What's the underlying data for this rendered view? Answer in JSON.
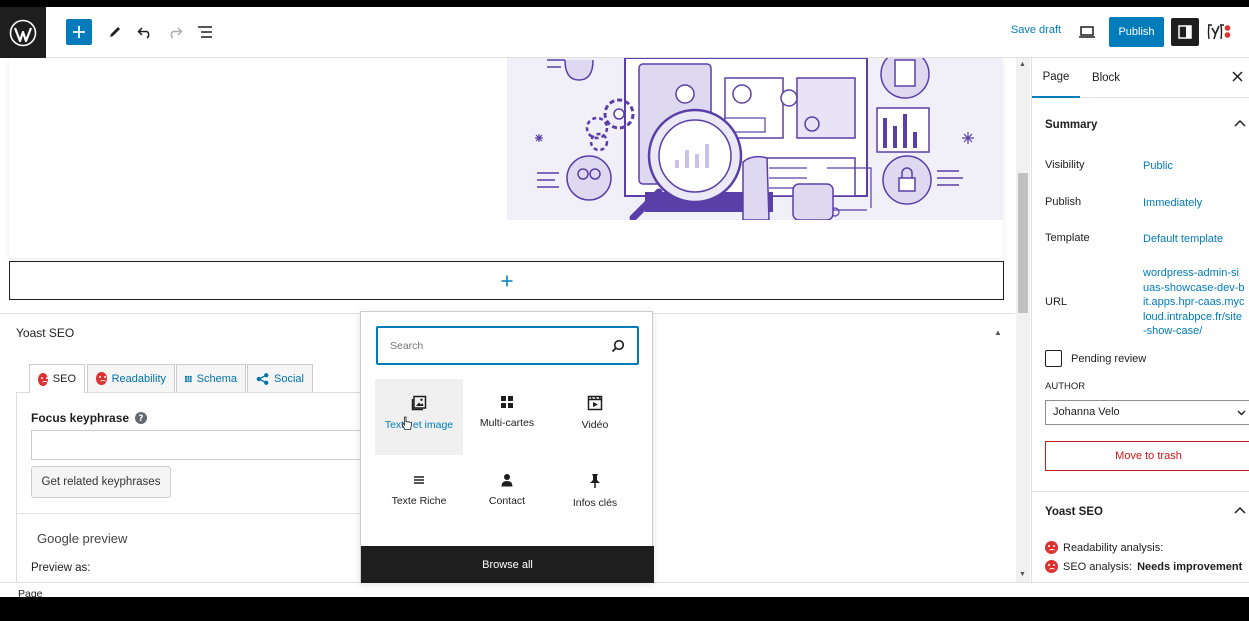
{
  "toolbar": {
    "save_draft": "Save draft",
    "publish": "Publish",
    "yoast_logo": "y"
  },
  "metabox": {
    "title": "Yoast SEO",
    "tabs": [
      {
        "label": "SEO",
        "icon": "sad-face-icon"
      },
      {
        "label": "Readability",
        "icon": "sad-face-icon"
      },
      {
        "label": "Schema",
        "icon": "grid-icon"
      },
      {
        "label": "Social",
        "icon": "share-icon"
      }
    ],
    "focus_keyphrase_label": "Focus keyphrase",
    "related_button": "Get related keyphrases",
    "google_preview": "Google preview",
    "preview_as": "Preview as:"
  },
  "inserter": {
    "search_placeholder": "Search",
    "blocks": [
      {
        "label": "Texte et image",
        "icon": "image-text-icon"
      },
      {
        "label": "Multi-cartes",
        "icon": "grid-icon"
      },
      {
        "label": "Vidéo",
        "icon": "video-icon"
      },
      {
        "label": "Texte Riche",
        "icon": "text-lines-icon"
      },
      {
        "label": "Contact",
        "icon": "person-icon"
      },
      {
        "label": "Infos clés",
        "icon": "pin-icon"
      }
    ],
    "browse_all": "Browse all"
  },
  "sidebar": {
    "tab_page": "Page",
    "tab_block": "Block",
    "summary_title": "Summary",
    "visibility_label": "Visibility",
    "visibility_value": "Public",
    "publish_label": "Publish",
    "publish_value": "Immediately",
    "template_label": "Template",
    "template_value": "Default template",
    "url_label": "URL",
    "url_value": "wordpress-admin-siuas-showcase-dev-bit.apps.hpr-caas.mycloud.intrabpce.fr/site-show-case/",
    "pending_review": "Pending review",
    "author_label": "AUTHOR",
    "author_value": "Johanna Velo",
    "move_to_trash": "Move to trash",
    "yoast_title": "Yoast SEO",
    "readability_analysis": "Readability analysis:",
    "seo_analysis_prefix": "SEO analysis:",
    "seo_analysis_value": "Needs improvement"
  },
  "footer": {
    "breadcrumb": "Page"
  },
  "colors": {
    "accent": "#007cba",
    "dark": "#1e1e1e",
    "danger": "#cc1818",
    "yoast_red": "#dc3232"
  }
}
